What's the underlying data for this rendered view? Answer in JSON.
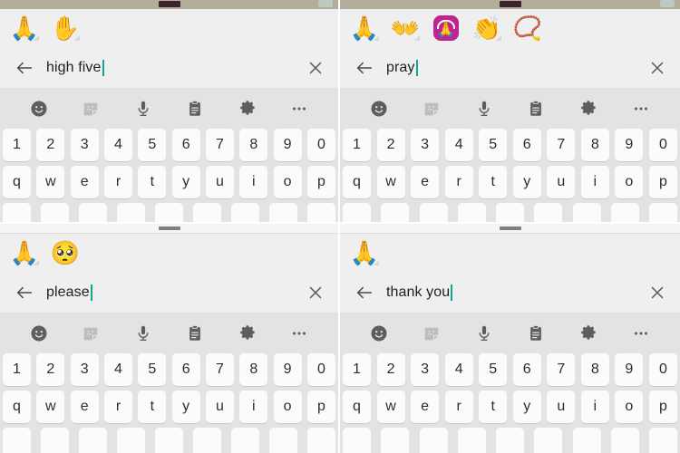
{
  "meta": {
    "description": "Four stacked Android emoji-keyboard search screenshots",
    "accent_caret_color": "#12a594",
    "status_bar_color": "#b3ad9b",
    "keyboard_bg_color": "#e3e3e3",
    "key_color": "#fbfbfb",
    "panel_bg_color": "#efefef",
    "app_icon_color": "#c0258f"
  },
  "icons": {
    "back": "back-arrow-icon",
    "clear": "close-icon",
    "emoji": "emoji-smiley-icon",
    "sticker": "sticker-icon",
    "mic": "microphone-icon",
    "clipboard": "clipboard-icon",
    "settings": "gear-icon",
    "more": "more-dots-icon"
  },
  "keyboard": {
    "toolbar": [
      {
        "name": "emoji-smiley-icon",
        "label": "Emoji",
        "dim": false
      },
      {
        "name": "sticker-icon",
        "label": "Stickers",
        "dim": true
      },
      {
        "name": "microphone-icon",
        "label": "Voice input",
        "dim": false
      },
      {
        "name": "clipboard-icon",
        "label": "Clipboard",
        "dim": false
      },
      {
        "name": "gear-icon",
        "label": "Settings",
        "dim": false
      },
      {
        "name": "more-dots-icon",
        "label": "More",
        "dim": false
      }
    ],
    "row_numbers": [
      "1",
      "2",
      "3",
      "4",
      "5",
      "6",
      "7",
      "8",
      "9",
      "0"
    ],
    "row_letters": [
      "q",
      "w",
      "e",
      "r",
      "t",
      "y",
      "u",
      "i",
      "o",
      "p"
    ],
    "row_third_count": 9
  },
  "panels": [
    {
      "id": "panel-high-five",
      "status_strip": "dark",
      "query": "high five",
      "results": [
        {
          "name": "folded-hands-emoji",
          "glyph": "🙏",
          "tone_marker": true
        },
        {
          "name": "raised-hand-emoji",
          "glyph": "✋",
          "tone_marker": true
        }
      ]
    },
    {
      "id": "panel-pray",
      "status_strip": "dark",
      "query": "pray",
      "results": [
        {
          "name": "folded-hands-emoji",
          "glyph": "🙏",
          "tone_marker": true
        },
        {
          "name": "open-hands-emoji",
          "glyph": "👐",
          "tone_marker": true
        },
        {
          "name": "pray-app-icon",
          "glyph": "🙏",
          "app_icon": true,
          "tone_marker": false
        },
        {
          "name": "clapping-hands-emoji",
          "glyph": "👏",
          "tone_marker": true
        },
        {
          "name": "prayer-beads-emoji",
          "glyph": "📿",
          "tone_marker": false
        }
      ]
    },
    {
      "id": "panel-please",
      "status_strip": "light",
      "query": "please",
      "results": [
        {
          "name": "folded-hands-emoji",
          "glyph": "🙏",
          "tone_marker": true
        },
        {
          "name": "pleading-face-emoji",
          "glyph": "🥺",
          "tone_marker": false
        }
      ]
    },
    {
      "id": "panel-thank-you",
      "status_strip": "light",
      "query": "thank you",
      "results": [
        {
          "name": "folded-hands-emoji",
          "glyph": "🙏",
          "tone_marker": true
        }
      ]
    }
  ]
}
